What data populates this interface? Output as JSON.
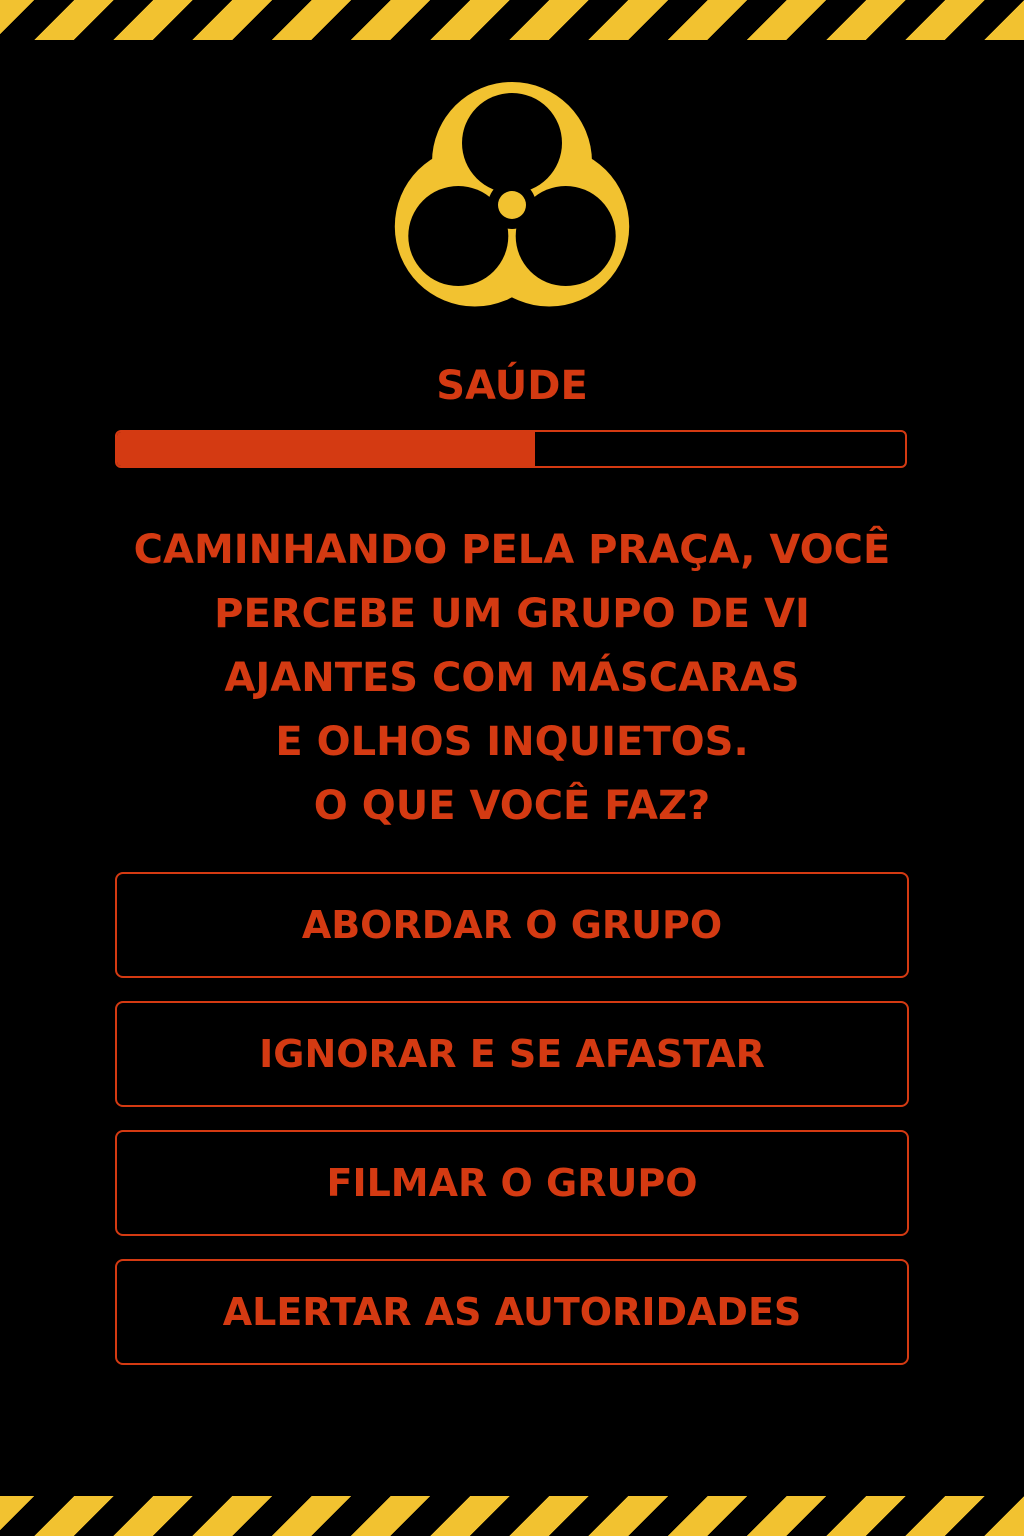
{
  "colors": {
    "accent": "#d43a12",
    "hazard_yellow": "#f2c230",
    "background": "#000000"
  },
  "icon": "biohazard-icon",
  "health": {
    "label": "SAÚDE",
    "fraction": 0.53
  },
  "prompt": {
    "lines": [
      "CAMINHANDO PELA PRAÇA, VOCÊ",
      "PERCEBE UM GRUPO DE VI",
      "AJANTES COM MÁSCARAS",
      "E OLHOS INQUIETOS.",
      "O QUE VOCÊ FAZ?"
    ]
  },
  "choices": [
    "ABORDAR O GRUPO",
    "IGNORAR E SE AFASTAR",
    "FILMAR O GRUPO",
    "ALERTAR AS AUTORIDADES"
  ]
}
